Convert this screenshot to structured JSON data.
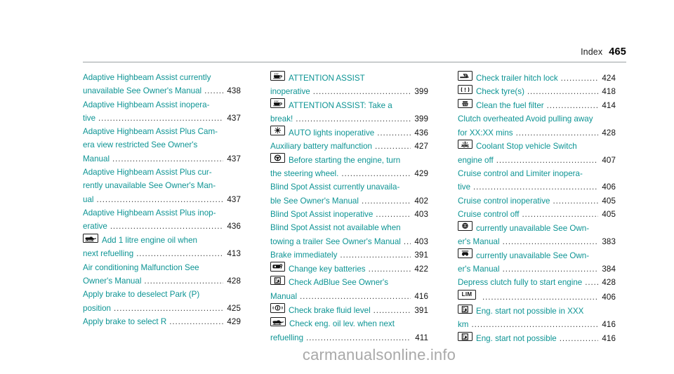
{
  "header": {
    "label": "Index",
    "page_number": "465"
  },
  "watermark": {
    "text": "carmanualsonline.info"
  },
  "colors": {
    "entry_text": "#0d9494",
    "page_number": "#111111",
    "leader_dots": "#3a3a3a",
    "rule": "#9aa0a3",
    "watermark": "#a9a9a9"
  },
  "columns": [
    {
      "entries": [
        {
          "icon": null,
          "lines": [
            "Adaptive Highbeam Assist currently",
            "unavailable See Owner's Manual"
          ],
          "page": "438"
        },
        {
          "icon": null,
          "lines": [
            "Adaptive Highbeam Assist inopera-",
            "tive"
          ],
          "page": "437"
        },
        {
          "icon": null,
          "lines": [
            "Adaptive Highbeam Assist Plus Cam-",
            "era view restricted See Owner's",
            "Manual"
          ],
          "page": "437"
        },
        {
          "icon": null,
          "lines": [
            "Adaptive Highbeam Assist Plus cur-",
            "rently unavailable See Owner's Man-",
            "ual"
          ],
          "page": "437"
        },
        {
          "icon": null,
          "lines": [
            "Adaptive Highbeam Assist Plus inop-",
            "erative"
          ],
          "page": "436"
        },
        {
          "icon": "oil-can-icon",
          "lines": [
            "Add 1 litre engine oil when",
            "next refuelling"
          ],
          "page": "413"
        },
        {
          "icon": null,
          "lines": [
            "Air conditioning Malfunction See",
            "Owner's Manual"
          ],
          "page": "428"
        },
        {
          "icon": null,
          "lines": [
            "Apply brake to deselect Park (P)",
            "position"
          ],
          "page": "425"
        },
        {
          "icon": null,
          "lines": [
            "Apply brake to select R"
          ],
          "page": "429"
        }
      ]
    },
    {
      "entries": [
        {
          "icon": "coffee-cup-icon",
          "lines": [
            "ATTENTION ASSIST",
            "inoperative"
          ],
          "page": "399"
        },
        {
          "icon": "coffee-cup-icon",
          "lines": [
            "ATTENTION ASSIST: Take a",
            "break!"
          ],
          "page": "399"
        },
        {
          "icon": "auto-lights-icon",
          "lines": [
            "AUTO lights inoperative"
          ],
          "page": "436"
        },
        {
          "icon": null,
          "lines": [
            "Auxiliary battery malfunction"
          ],
          "page": "427"
        },
        {
          "icon": "steering-wheel-icon",
          "lines": [
            "Before starting the engine, turn",
            "the steering wheel."
          ],
          "page": "429"
        },
        {
          "icon": null,
          "lines": [
            "Blind Spot Assist currently unavaila-",
            "ble See Owner's Manual"
          ],
          "page": "402"
        },
        {
          "icon": null,
          "lines": [
            "Blind Spot Assist inoperative"
          ],
          "page": "403"
        },
        {
          "icon": null,
          "lines": [
            "Blind Spot Assist not available when",
            "towing a trailer See Owner's Manual"
          ],
          "page": "403",
          "short_leader": true
        },
        {
          "icon": null,
          "lines": [
            "Brake immediately"
          ],
          "page": "391"
        },
        {
          "icon": "key-battery-icon",
          "lines": [
            "Change key batteries"
          ],
          "page": "422"
        },
        {
          "icon": "adblue-icon",
          "lines": [
            "Check AdBlue See Owner's",
            "Manual"
          ],
          "page": "416"
        },
        {
          "icon": "brake-fluid-icon",
          "lines": [
            "Check brake fluid level"
          ],
          "page": "391"
        },
        {
          "icon": "oil-can-icon",
          "lines": [
            "Check eng. oil lev. when next",
            "refuelling"
          ],
          "page": "411"
        }
      ]
    },
    {
      "entries": [
        {
          "icon": "trailer-hitch-icon",
          "lines": [
            "Check trailer hitch lock"
          ],
          "page": "424"
        },
        {
          "icon": "tyre-pressure-icon",
          "lines": [
            "Check tyre(s)"
          ],
          "page": "418"
        },
        {
          "icon": "fuel-filter-icon",
          "lines": [
            "Clean the fuel filter"
          ],
          "page": "414"
        },
        {
          "icon": null,
          "lines": [
            "Clutch overheated Avoid pulling away",
            "for XX:XX mins"
          ],
          "page": "428"
        },
        {
          "icon": "coolant-icon",
          "lines": [
            "Coolant Stop vehicle Switch",
            "engine off"
          ],
          "page": "407"
        },
        {
          "icon": null,
          "lines": [
            "Cruise control and Limiter inopera-",
            "tive"
          ],
          "page": "406"
        },
        {
          "icon": null,
          "lines": [
            "Cruise control inoperative"
          ],
          "page": "405"
        },
        {
          "icon": null,
          "lines": [
            "Cruise control off"
          ],
          "page": "405"
        },
        {
          "icon": "cruise-control-icon",
          "lines": [
            "currently unavailable See Own-",
            "er's Manual"
          ],
          "page": "383"
        },
        {
          "icon": "distance-assist-icon",
          "lines": [
            "currently unavailable See Own-",
            "er's Manual"
          ],
          "page": "384"
        },
        {
          "icon": null,
          "lines": [
            "Depress clutch fully to start engine"
          ],
          "page": "428",
          "short_leader": true
        },
        {
          "icon": "lim-icon",
          "lines": [
            ""
          ],
          "page": "406"
        },
        {
          "icon": "adblue-icon",
          "lines": [
            "Eng. start not possible in XXX",
            "km"
          ],
          "page": "416"
        },
        {
          "icon": "adblue-icon",
          "lines": [
            "Eng. start not possible"
          ],
          "page": "416"
        }
      ]
    }
  ]
}
